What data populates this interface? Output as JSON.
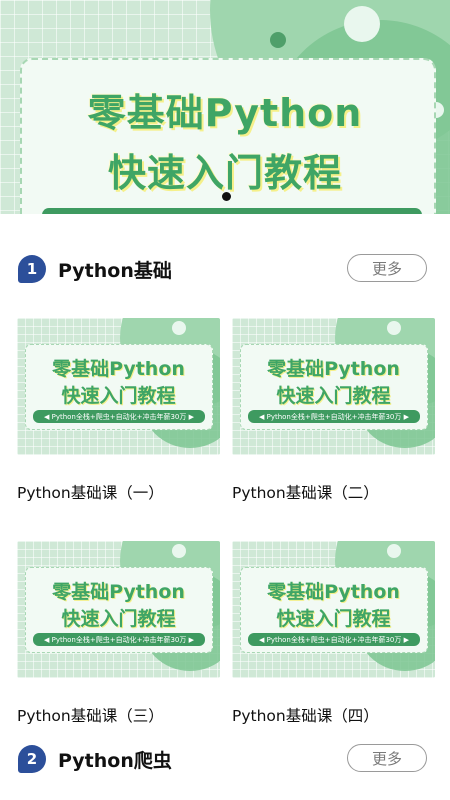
{
  "banner": {
    "title_line1": "零基础Python",
    "title_line2": "快速入门教程"
  },
  "sections": [
    {
      "number": "1",
      "title": "Python基础",
      "more_label": "更多"
    },
    {
      "number": "2",
      "title": "Python爬虫",
      "more_label": "更多"
    }
  ],
  "courses": [
    {
      "thumb_line1": "零基础Python",
      "thumb_line2": "快速入门教程",
      "ribbon": "◀ Python全栈+爬虫+自动化+冲击年薪30万 ▶",
      "title": "Python基础课（一）"
    },
    {
      "thumb_line1": "零基础Python",
      "thumb_line2": "快速入门教程",
      "ribbon": "◀ Python全栈+爬虫+自动化+冲击年薪30万 ▶",
      "title": "Python基础课（二）"
    },
    {
      "thumb_line1": "零基础Python",
      "thumb_line2": "快速入门教程",
      "ribbon": "◀ Python全栈+爬虫+自动化+冲击年薪30万 ▶",
      "title": "Python基础课（三）"
    },
    {
      "thumb_line1": "零基础Python",
      "thumb_line2": "快速入门教程",
      "ribbon": "◀ Python全栈+爬虫+自动化+冲击年薪30万 ▶",
      "title": "Python基础课（四）"
    }
  ],
  "colors": {
    "badge": "#2c4f9a",
    "accent_green": "#3fa565"
  }
}
